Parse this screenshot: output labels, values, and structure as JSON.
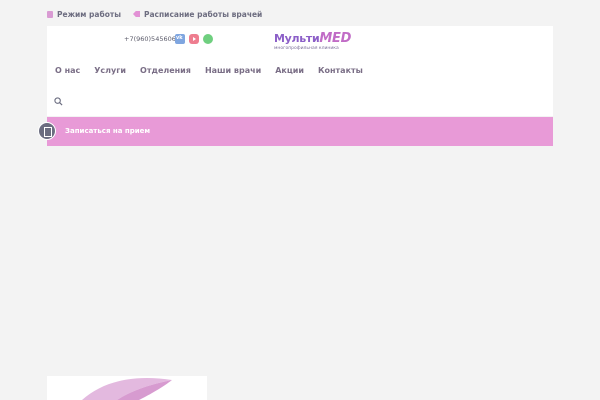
{
  "topbar": {
    "items": [
      {
        "label": "Режим работы",
        "icon": "calendar-icon"
      },
      {
        "label": "Расписание работы врачей",
        "icon": "tag-icon"
      }
    ]
  },
  "header": {
    "phone": "+7(960)5456060",
    "social": [
      "vk-icon",
      "youtube-icon",
      "whatsapp-icon"
    ],
    "logo": {
      "main": "Мульти",
      "accent": "MED",
      "subtitle": "многопрофильная клиника"
    },
    "nav": [
      "О нас",
      "Услуги",
      "Отделения",
      "Наши врачи",
      "Акции",
      "Контакты"
    ]
  },
  "appointment": {
    "label": "Записаться на прием"
  },
  "colors": {
    "accent": "#e89ad7",
    "nav_text": "#7a6e86",
    "logo": "#8c5fc8"
  }
}
